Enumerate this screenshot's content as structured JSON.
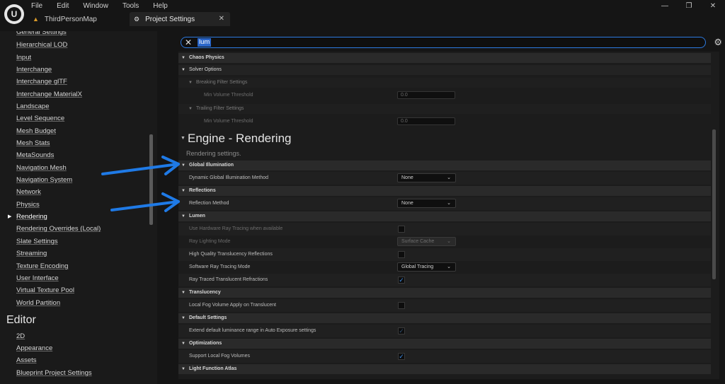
{
  "menu": [
    "File",
    "Edit",
    "Window",
    "Tools",
    "Help"
  ],
  "window_controls": {
    "minimize": "—",
    "maximize": "❐",
    "close": "✕"
  },
  "tabs": [
    {
      "label": "ThirdPersonMap",
      "icon": "▲"
    },
    {
      "label": "Project Settings",
      "icon": "⚙",
      "close": "✕"
    }
  ],
  "sidebar": {
    "items": [
      "General Settings",
      "Hierarchical LOD",
      "Input",
      "Interchange",
      "Interchange glTF",
      "Interchange MaterialX",
      "Landscape",
      "Level Sequence",
      "Mesh Budget",
      "Mesh Stats",
      "MetaSounds",
      "Navigation Mesh",
      "Navigation System",
      "Network",
      "Physics",
      "Rendering",
      "Rendering Overrides (Local)",
      "Slate Settings",
      "Streaming",
      "Texture Encoding",
      "User Interface",
      "Virtual Texture Pool",
      "World Partition"
    ],
    "active": "Rendering",
    "editor_heading": "Editor",
    "editor_items": [
      "2D",
      "Appearance",
      "Assets",
      "Blueprint Project Settings"
    ]
  },
  "search": {
    "value": "lum",
    "clear_icon": "✕",
    "settings_icon": "⚙"
  },
  "panel": {
    "chaos": {
      "category": "Chaos Physics",
      "solver": "Solver Options",
      "breaking": "Breaking Filter Settings",
      "breaking_prop": "Min Volume Threshold",
      "breaking_val": "0.0",
      "trailing": "Trailing Filter Settings",
      "trailing_prop": "Min Volume Threshold",
      "trailing_val": "0.0"
    },
    "section_title": "Engine - Rendering",
    "section_subtitle": "Rendering settings.",
    "gi": {
      "category": "Global Illumination",
      "prop": "Dynamic Global Illumination Method",
      "value": "None"
    },
    "reflections": {
      "category": "Reflections",
      "prop": "Reflection Method",
      "value": "None"
    },
    "lumen": {
      "category": "Lumen",
      "hw_rt": "Use Hardware Ray Tracing when available",
      "ray_lighting": "Ray Lighting Mode",
      "ray_lighting_val": "Surface Cache",
      "hq_transl": "High Quality Translucency Reflections",
      "sw_rt": "Software Ray Tracing Mode",
      "sw_rt_val": "Global Tracing",
      "rt_refr": "Ray Traced Translucent Refractions"
    },
    "translucency": {
      "category": "Translucency",
      "prop": "Local Fog Volume Apply on Translucent"
    },
    "defaults": {
      "category": "Default Settings",
      "prop": "Extend default luminance range in Auto Exposure settings"
    },
    "optimizations": {
      "category": "Optimizations",
      "prop": "Support Local Fog Volumes"
    },
    "lfa": {
      "category": "Light Function Atlas"
    },
    "check_mark": "✓",
    "chevron": "⌄"
  },
  "colors": {
    "accent": "#2c7ae0",
    "arrow": "#1f7ae6"
  }
}
